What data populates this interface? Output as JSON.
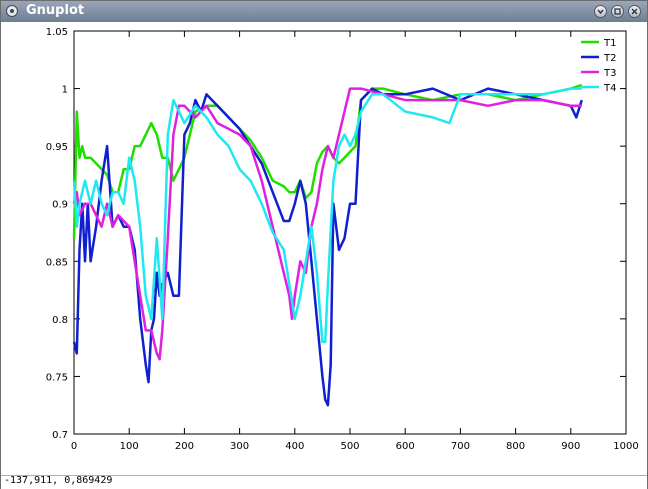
{
  "window": {
    "title": "Gnuplot"
  },
  "status": {
    "coordinates": "-137,911,  0,869429"
  },
  "chart_data": {
    "type": "line",
    "title": "",
    "xlabel": "",
    "ylabel": "",
    "xlim": [
      0,
      1000
    ],
    "ylim": [
      0.7,
      1.05
    ],
    "x_ticks": [
      0,
      100,
      200,
      300,
      400,
      500,
      600,
      700,
      800,
      900,
      1000
    ],
    "x_tick_labels": [
      "0",
      "100",
      "200",
      "300",
      "400",
      "500",
      "600",
      "700",
      "800",
      "900",
      "1000"
    ],
    "y_ticks": [
      0.7,
      0.75,
      0.8,
      0.85,
      0.9,
      0.95,
      1.0,
      1.05
    ],
    "y_tick_labels": [
      "0.7",
      "0.75",
      "0.8",
      "0.85",
      "0.9",
      "0.95",
      "1",
      "1.05"
    ],
    "grid": false,
    "legend_position": "top-right",
    "series": [
      {
        "name": "T1",
        "color": "#22dd00",
        "x": [
          0,
          5,
          10,
          15,
          20,
          30,
          40,
          50,
          60,
          70,
          80,
          90,
          100,
          110,
          120,
          130,
          140,
          150,
          160,
          170,
          180,
          190,
          200,
          220,
          240,
          260,
          280,
          300,
          320,
          340,
          360,
          380,
          390,
          400,
          410,
          420,
          430,
          440,
          450,
          460,
          470,
          480,
          490,
          500,
          510,
          520,
          540,
          560,
          600,
          650,
          700,
          750,
          800,
          850,
          900,
          920
        ],
        "y": [
          0.87,
          0.98,
          0.94,
          0.95,
          0.94,
          0.94,
          0.935,
          0.93,
          0.925,
          0.91,
          0.91,
          0.93,
          0.93,
          0.95,
          0.95,
          0.96,
          0.97,
          0.96,
          0.94,
          0.94,
          0.92,
          0.93,
          0.94,
          0.98,
          0.985,
          0.985,
          0.975,
          0.965,
          0.955,
          0.94,
          0.92,
          0.915,
          0.91,
          0.91,
          0.92,
          0.905,
          0.91,
          0.935,
          0.945,
          0.95,
          0.94,
          0.935,
          0.94,
          0.945,
          0.95,
          0.99,
          1.0,
          1.0,
          0.995,
          0.99,
          0.995,
          0.995,
          0.99,
          0.995,
          1.0,
          1.003
        ]
      },
      {
        "name": "T2",
        "color": "#1020d0",
        "x": [
          0,
          5,
          10,
          15,
          20,
          25,
          30,
          40,
          50,
          60,
          70,
          80,
          90,
          100,
          110,
          120,
          130,
          135,
          140,
          145,
          150,
          155,
          160,
          170,
          180,
          190,
          200,
          210,
          220,
          230,
          240,
          250,
          260,
          280,
          300,
          320,
          340,
          360,
          380,
          390,
          400,
          410,
          420,
          430,
          440,
          450,
          455,
          460,
          465,
          470,
          480,
          490,
          500,
          510,
          520,
          540,
          560,
          600,
          650,
          700,
          750,
          800,
          850,
          900,
          910,
          920
        ],
        "y": [
          0.78,
          0.77,
          0.86,
          0.9,
          0.85,
          0.9,
          0.85,
          0.88,
          0.92,
          0.95,
          0.88,
          0.89,
          0.88,
          0.88,
          0.86,
          0.8,
          0.76,
          0.745,
          0.79,
          0.8,
          0.84,
          0.82,
          0.83,
          0.84,
          0.82,
          0.82,
          0.96,
          0.97,
          0.99,
          0.98,
          0.995,
          0.99,
          0.985,
          0.975,
          0.965,
          0.95,
          0.935,
          0.91,
          0.885,
          0.885,
          0.9,
          0.92,
          0.9,
          0.85,
          0.8,
          0.75,
          0.73,
          0.725,
          0.76,
          0.9,
          0.86,
          0.87,
          0.9,
          0.9,
          0.99,
          1.0,
          0.995,
          0.995,
          1.0,
          0.99,
          1.0,
          0.995,
          0.99,
          0.985,
          0.975,
          0.99
        ]
      },
      {
        "name": "T3",
        "color": "#e020e0",
        "x": [
          0,
          5,
          10,
          20,
          30,
          40,
          50,
          60,
          70,
          80,
          90,
          100,
          110,
          120,
          130,
          140,
          150,
          155,
          160,
          170,
          180,
          190,
          200,
          220,
          240,
          260,
          280,
          300,
          320,
          340,
          360,
          380,
          390,
          395,
          400,
          410,
          420,
          430,
          440,
          450,
          460,
          470,
          480,
          490,
          500,
          520,
          560,
          600,
          650,
          700,
          750,
          800,
          850,
          900,
          920
        ],
        "y": [
          0.9,
          0.91,
          0.89,
          0.9,
          0.9,
          0.89,
          0.88,
          0.9,
          0.88,
          0.89,
          0.885,
          0.88,
          0.85,
          0.82,
          0.79,
          0.79,
          0.77,
          0.765,
          0.79,
          0.87,
          0.96,
          0.985,
          0.985,
          0.975,
          0.985,
          0.97,
          0.965,
          0.96,
          0.95,
          0.92,
          0.88,
          0.84,
          0.82,
          0.8,
          0.82,
          0.85,
          0.84,
          0.88,
          0.9,
          0.93,
          0.95,
          0.94,
          0.96,
          0.98,
          1.0,
          1.0,
          0.995,
          0.99,
          0.99,
          0.99,
          0.985,
          0.99,
          0.99,
          0.985,
          0.985
        ]
      },
      {
        "name": "T4",
        "color": "#20e8f0",
        "x": [
          0,
          5,
          10,
          20,
          30,
          40,
          50,
          60,
          70,
          80,
          90,
          100,
          110,
          120,
          130,
          140,
          150,
          160,
          170,
          180,
          190,
          200,
          220,
          240,
          260,
          280,
          300,
          320,
          340,
          360,
          380,
          390,
          400,
          410,
          420,
          430,
          440,
          450,
          455,
          460,
          470,
          480,
          490,
          500,
          510,
          520,
          540,
          560,
          600,
          650,
          680,
          700,
          750,
          800,
          850,
          900,
          920
        ],
        "y": [
          0.92,
          0.88,
          0.9,
          0.92,
          0.9,
          0.92,
          0.9,
          0.89,
          0.91,
          0.91,
          0.9,
          0.94,
          0.92,
          0.88,
          0.82,
          0.8,
          0.87,
          0.8,
          0.96,
          0.99,
          0.98,
          0.97,
          0.985,
          0.975,
          0.96,
          0.95,
          0.93,
          0.92,
          0.9,
          0.875,
          0.86,
          0.83,
          0.8,
          0.82,
          0.85,
          0.88,
          0.84,
          0.78,
          0.78,
          0.83,
          0.92,
          0.95,
          0.96,
          0.95,
          0.96,
          0.98,
          0.995,
          0.995,
          0.98,
          0.975,
          0.97,
          0.995,
          0.995,
          0.995,
          0.995,
          1.0,
          1.0
        ]
      }
    ]
  }
}
